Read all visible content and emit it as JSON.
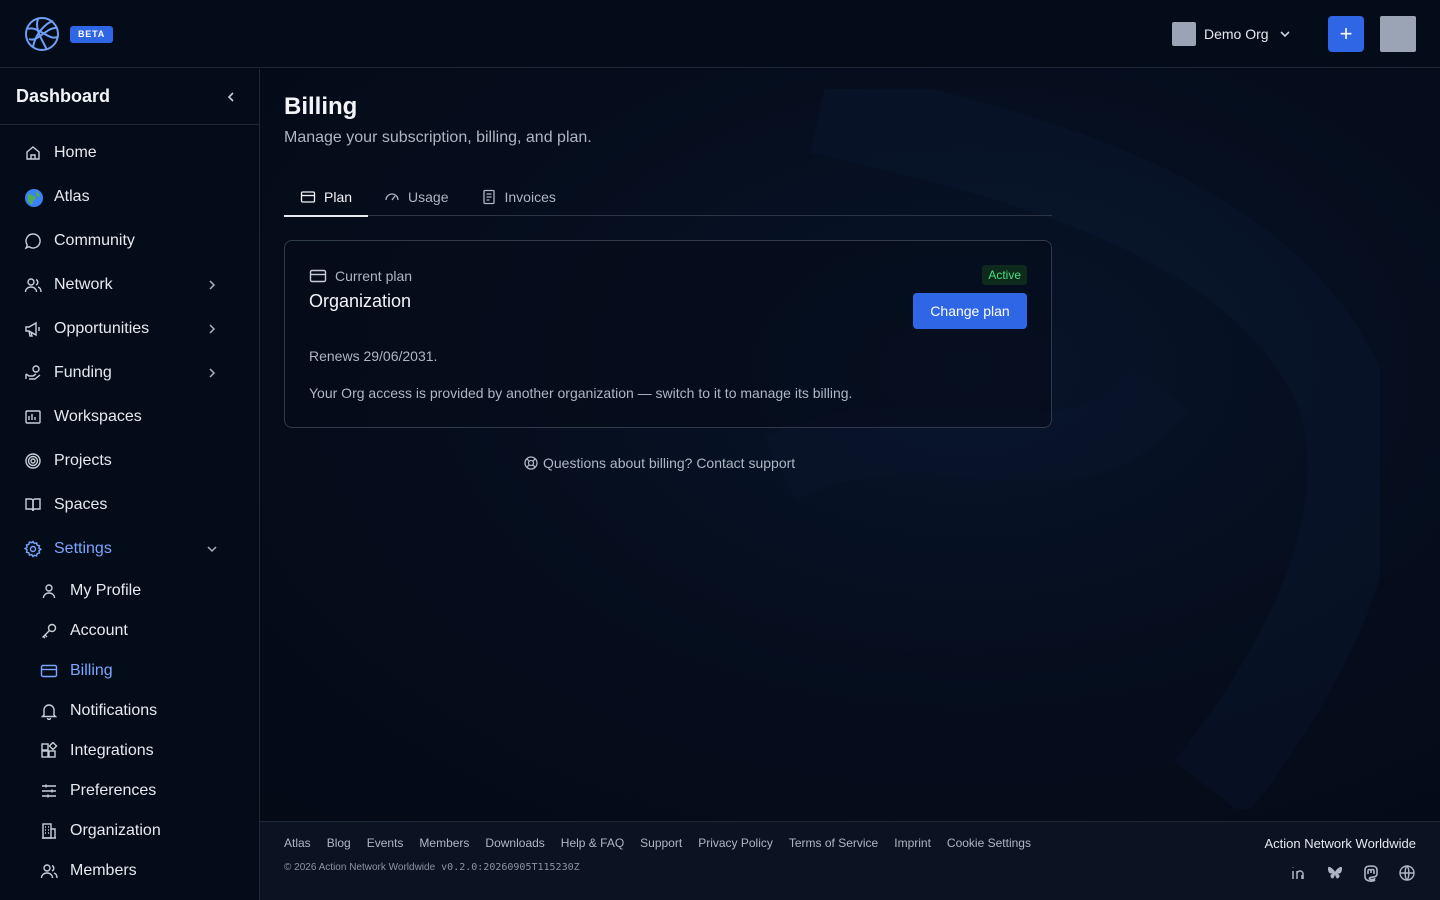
{
  "header": {
    "beta_label": "BETA",
    "org_name": "Demo Org",
    "add_label": "+"
  },
  "sidebar": {
    "title": "Dashboard",
    "items": [
      {
        "label": "Home",
        "icon": "home-icon"
      },
      {
        "label": "Atlas",
        "icon": "globe-icon"
      },
      {
        "label": "Community",
        "icon": "chat-icon"
      },
      {
        "label": "Network",
        "icon": "users-icon"
      },
      {
        "label": "Opportunities",
        "icon": "megaphone-icon"
      },
      {
        "label": "Funding",
        "icon": "funding-icon"
      },
      {
        "label": "Workspaces",
        "icon": "workspace-icon"
      },
      {
        "label": "Projects",
        "icon": "target-icon"
      },
      {
        "label": "Spaces",
        "icon": "book-icon"
      },
      {
        "label": "Settings",
        "icon": "gear-icon"
      }
    ],
    "settings_items": [
      {
        "label": "My Profile",
        "icon": "user-icon"
      },
      {
        "label": "Account",
        "icon": "key-icon"
      },
      {
        "label": "Billing",
        "icon": "credit-card-icon"
      },
      {
        "label": "Notifications",
        "icon": "bell-icon"
      },
      {
        "label": "Integrations",
        "icon": "puzzle-icon"
      },
      {
        "label": "Preferences",
        "icon": "sliders-icon"
      },
      {
        "label": "Organization",
        "icon": "building-icon"
      },
      {
        "label": "Members",
        "icon": "users-icon"
      }
    ]
  },
  "main": {
    "title": "Billing",
    "subtitle": "Manage your subscription, billing, and plan.",
    "tabs": [
      {
        "label": "Plan",
        "icon": "credit-card-icon"
      },
      {
        "label": "Usage",
        "icon": "gauge-icon"
      },
      {
        "label": "Invoices",
        "icon": "invoice-icon"
      }
    ],
    "card": {
      "label": "Current plan",
      "plan_name": "Organization",
      "status": "Active",
      "change_label": "Change plan",
      "renews": "Renews 29/06/2031.",
      "note": "Your Org access is provided by another organization — switch to it to manage its billing."
    },
    "support_text": "Questions about billing? Contact support"
  },
  "footer": {
    "links": [
      "Atlas",
      "Blog",
      "Events",
      "Members",
      "Downloads",
      "Help & FAQ",
      "Support",
      "Privacy Policy",
      "Terms of Service",
      "Imprint",
      "Cookie Settings"
    ],
    "copyright": "© 2026 Action Network Worldwide",
    "version": "v0.2.0:20260905T115230Z",
    "brand": "Action Network Worldwide"
  },
  "colors": {
    "accent": "#2f66e6",
    "active_nav": "#7aa6ff",
    "status_active": "#4ade80",
    "background": "#040b18"
  }
}
